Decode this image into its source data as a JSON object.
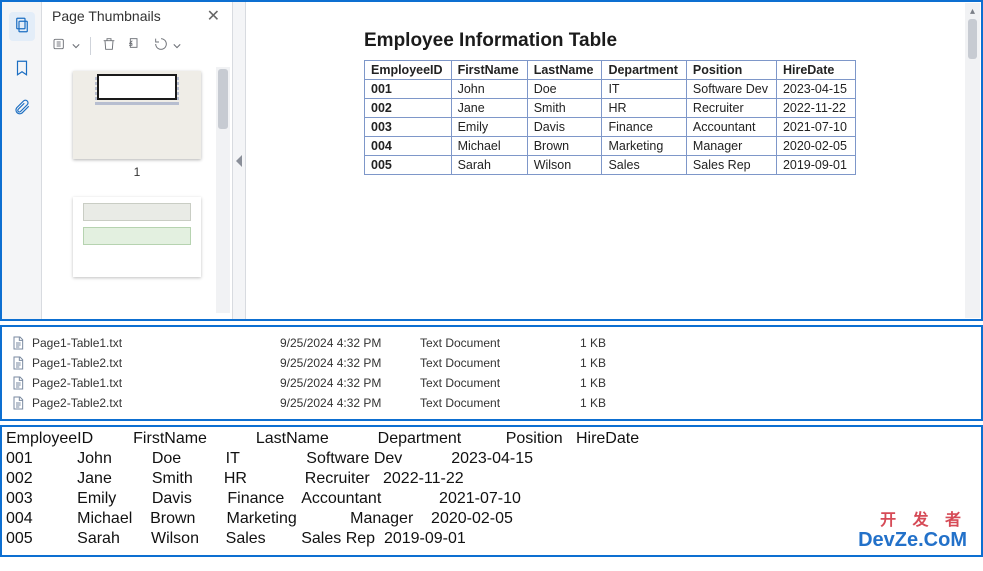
{
  "pdf": {
    "panel_title": "Page Thumbnails",
    "page1_label": "1",
    "doc_title": "Employee Information Table",
    "headers": [
      "EmployeeID",
      "FirstName",
      "LastName",
      "Department",
      "Position",
      "HireDate"
    ],
    "rows": [
      {
        "id": "001",
        "fn": "John",
        "ln": "Doe",
        "dept": "IT",
        "pos": "Software Dev",
        "hire": "2023-04-15"
      },
      {
        "id": "002",
        "fn": "Jane",
        "ln": "Smith",
        "dept": "HR",
        "pos": "Recruiter",
        "hire": "2022-11-22"
      },
      {
        "id": "003",
        "fn": "Emily",
        "ln": "Davis",
        "dept": "Finance",
        "pos": "Accountant",
        "hire": "2021-07-10"
      },
      {
        "id": "004",
        "fn": "Michael",
        "ln": "Brown",
        "dept": "Marketing",
        "pos": "Manager",
        "hire": "2020-02-05"
      },
      {
        "id": "005",
        "fn": "Sarah",
        "ln": "Wilson",
        "dept": "Sales",
        "pos": "Sales Rep",
        "hire": "2019-09-01"
      }
    ]
  },
  "files": [
    {
      "name": "Page1-Table1.txt",
      "date": "9/25/2024 4:32 PM",
      "type": "Text Document",
      "size": "1 KB"
    },
    {
      "name": "Page1-Table2.txt",
      "date": "9/25/2024 4:32 PM",
      "type": "Text Document",
      "size": "1 KB"
    },
    {
      "name": "Page2-Table1.txt",
      "date": "9/25/2024 4:32 PM",
      "type": "Text Document",
      "size": "1 KB"
    },
    {
      "name": "Page2-Table2.txt",
      "date": "9/25/2024 4:32 PM",
      "type": "Text Document",
      "size": "1 KB"
    }
  ],
  "textdump": {
    "header": "EmployeeID         FirstName           LastName           Department          Position   HireDate",
    "lines": [
      "001          John         Doe          IT               Software Dev           2023-04-15",
      "002          Jane         Smith       HR             Recruiter   2022-11-22",
      "003          Emily        Davis        Finance    Accountant             2021-07-10",
      "004          Michael    Brown       Marketing            Manager    2020-02-05",
      "005          Sarah       Wilson      Sales        Sales Rep  2019-09-01"
    ]
  },
  "watermark": {
    "cn": "开 发 者",
    "en": "DevZe.CoM"
  }
}
